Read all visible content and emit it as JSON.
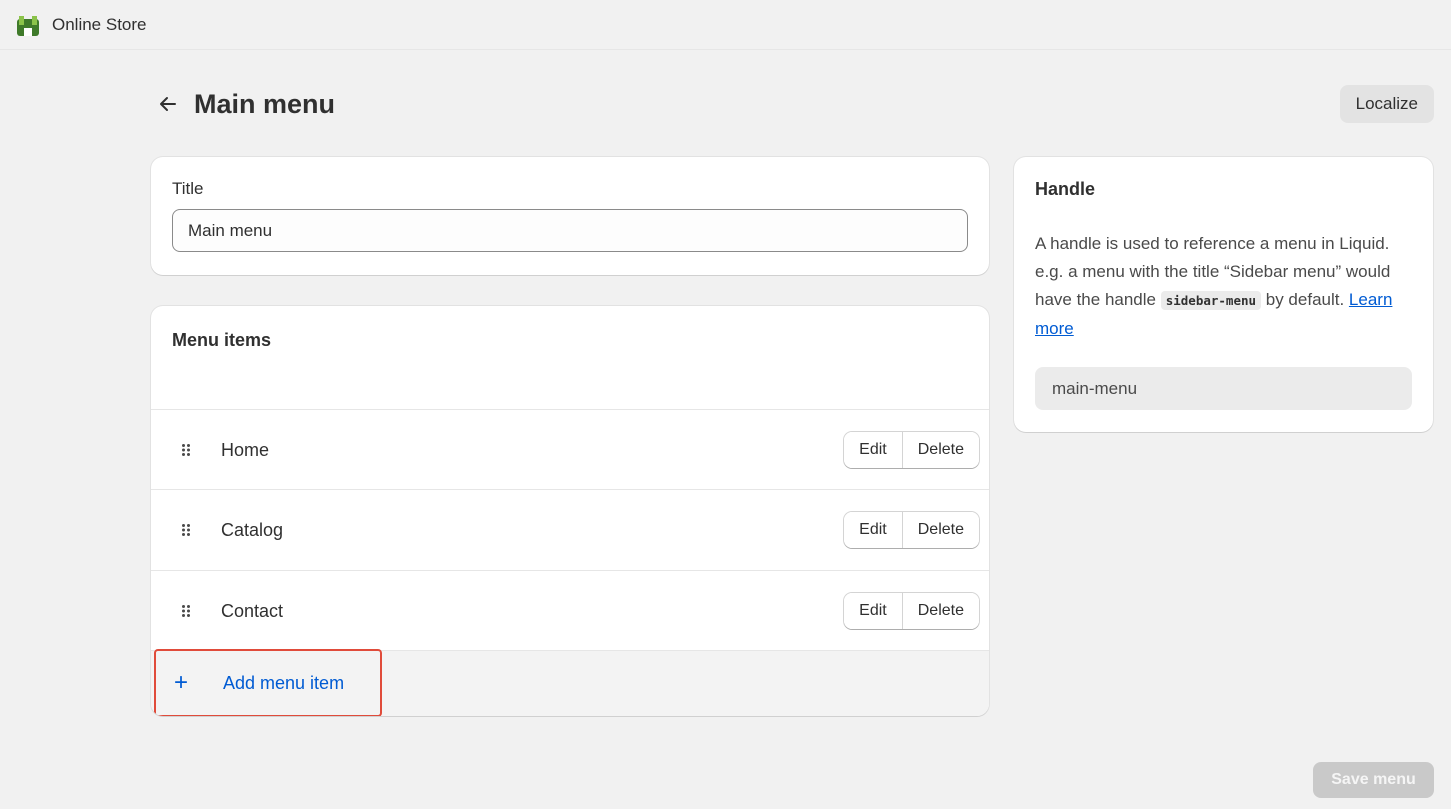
{
  "topbar": {
    "app_name": "Online Store",
    "icon": "store-app-icon"
  },
  "header": {
    "back_icon": "arrow-left-icon",
    "title": "Main menu",
    "localize_label": "Localize"
  },
  "title_card": {
    "label": "Title",
    "value": "Main menu"
  },
  "menu_items_card": {
    "heading": "Menu items",
    "items": [
      {
        "label": "Home",
        "edit_label": "Edit",
        "delete_label": "Delete"
      },
      {
        "label": "Catalog",
        "edit_label": "Edit",
        "delete_label": "Delete"
      },
      {
        "label": "Contact",
        "edit_label": "Edit",
        "delete_label": "Delete"
      }
    ],
    "add_label": "Add menu item",
    "add_icon": "plus-icon",
    "drag_icon": "drag-handle-icon"
  },
  "handle_card": {
    "heading": "Handle",
    "desc_part1": "A handle is used to reference a menu in Liquid. e.g. a menu with the title “Sidebar menu” would have the handle ",
    "code": "sidebar-menu",
    "desc_part2": " by default. ",
    "learn_more": "Learn more",
    "handle_value": "main-menu"
  },
  "footer": {
    "save_label": "Save menu"
  },
  "colors": {
    "accent": "#005bd3",
    "highlight": "#e04b3a",
    "background": "#f1f1f1"
  }
}
